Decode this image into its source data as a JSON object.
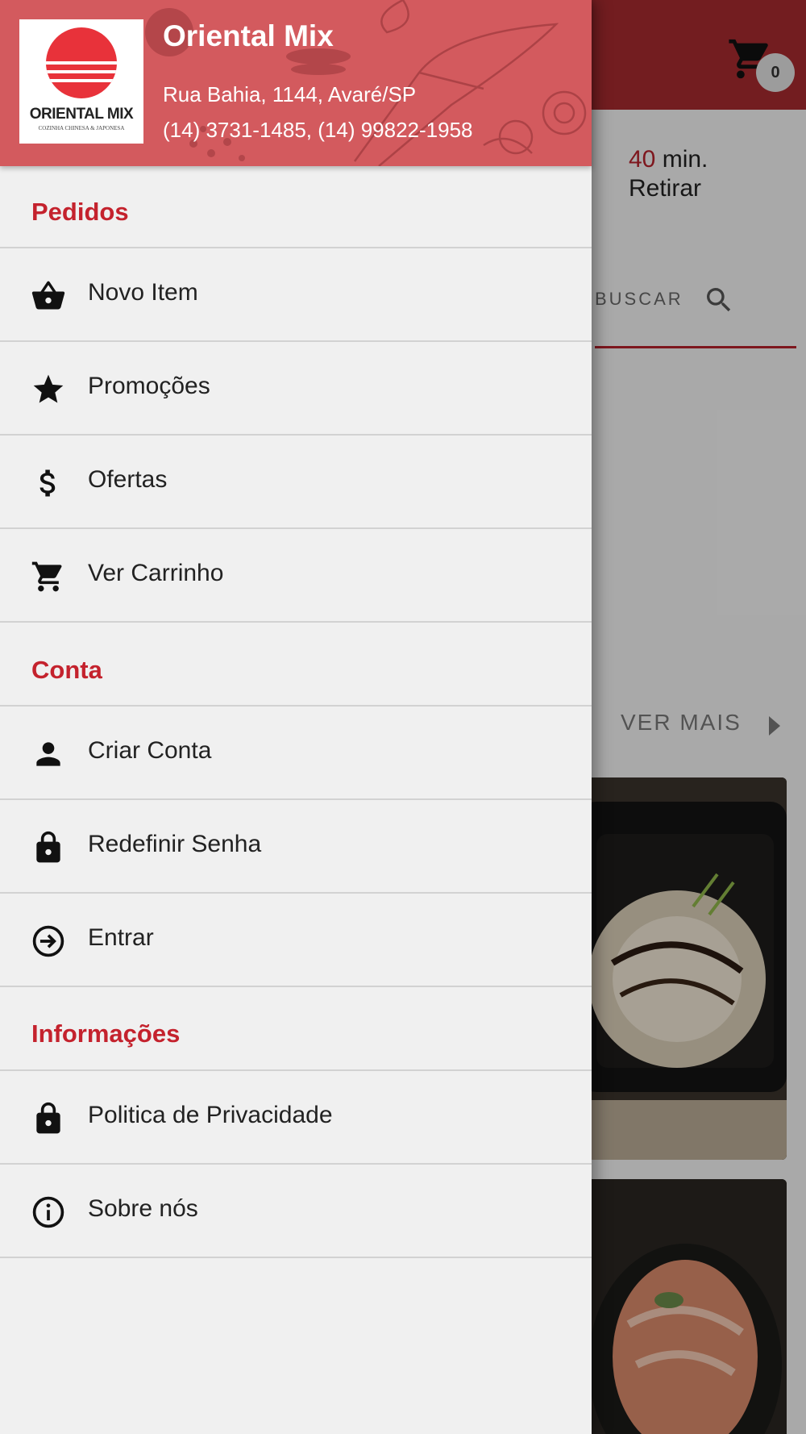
{
  "store": {
    "name": "Oriental Mix",
    "address": "Rua Bahia, 1144, Avaré/SP",
    "phones": "(14) 3731-1485, (14) 99822-1958",
    "logo_text": "ORIENTAL MIX",
    "logo_subtitle": "COZINHA CHINESA & JAPONESA"
  },
  "colors": {
    "accent": "#c4222d",
    "header_bg": "#d35a5e",
    "topbar_bg": "#a52a2f"
  },
  "sections": {
    "pedidos": "Pedidos",
    "conta": "Conta",
    "informacoes": "Informações"
  },
  "menu": {
    "novo_item": {
      "label": "Novo Item",
      "icon": "basket-icon"
    },
    "promocoes": {
      "label": "Promoções",
      "icon": "star-icon"
    },
    "ofertas": {
      "label": "Ofertas",
      "icon": "dollar-icon"
    },
    "ver_carrinho": {
      "label": "Ver Carrinho",
      "icon": "cart-icon"
    },
    "criar_conta": {
      "label": "Criar Conta",
      "icon": "person-icon"
    },
    "redefinir_senha": {
      "label": "Redefinir Senha",
      "icon": "lock-icon"
    },
    "entrar": {
      "label": "Entrar",
      "icon": "login-icon"
    },
    "politica": {
      "label": "Politica de Privacidade",
      "icon": "lock-icon"
    },
    "sobre": {
      "label": "Sobre nós",
      "icon": "info-icon"
    }
  },
  "background": {
    "cart_count": "0",
    "time_value": "40",
    "time_unit": "min.",
    "pickup": "Retirar",
    "search_label": "BUSCAR",
    "ver_mais": "VER MAIS"
  }
}
